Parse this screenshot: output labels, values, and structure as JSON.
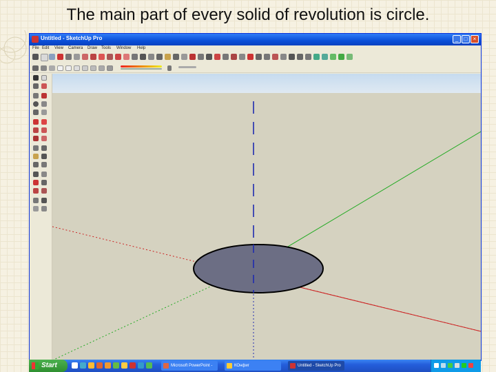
{
  "slide": {
    "title": "The main part of every solid of revolution is circle."
  },
  "window": {
    "title": "Untitled - SketchUp Pro",
    "minimize_glyph": "_",
    "maximize_glyph": "□",
    "close_glyph": "×"
  },
  "menu": {
    "items": [
      "File",
      "Edit",
      "View",
      "Camera",
      "Draw",
      "Tools",
      "Window",
      "Help"
    ]
  },
  "taskbar": {
    "start_label": "Start",
    "tasks": [
      {
        "label": "Microsoft PowerPoint -"
      },
      {
        "label": "КОнфиг"
      },
      {
        "label": "Untitled - SketchUp Pro"
      }
    ]
  },
  "colors": {
    "sky": "#c6dbef",
    "ground": "#d5d2c0",
    "circle_fill": "#6c6e84",
    "axis_red": "#cc2222",
    "axis_green": "#22aa22",
    "axis_blue": "#1f2bb0"
  }
}
